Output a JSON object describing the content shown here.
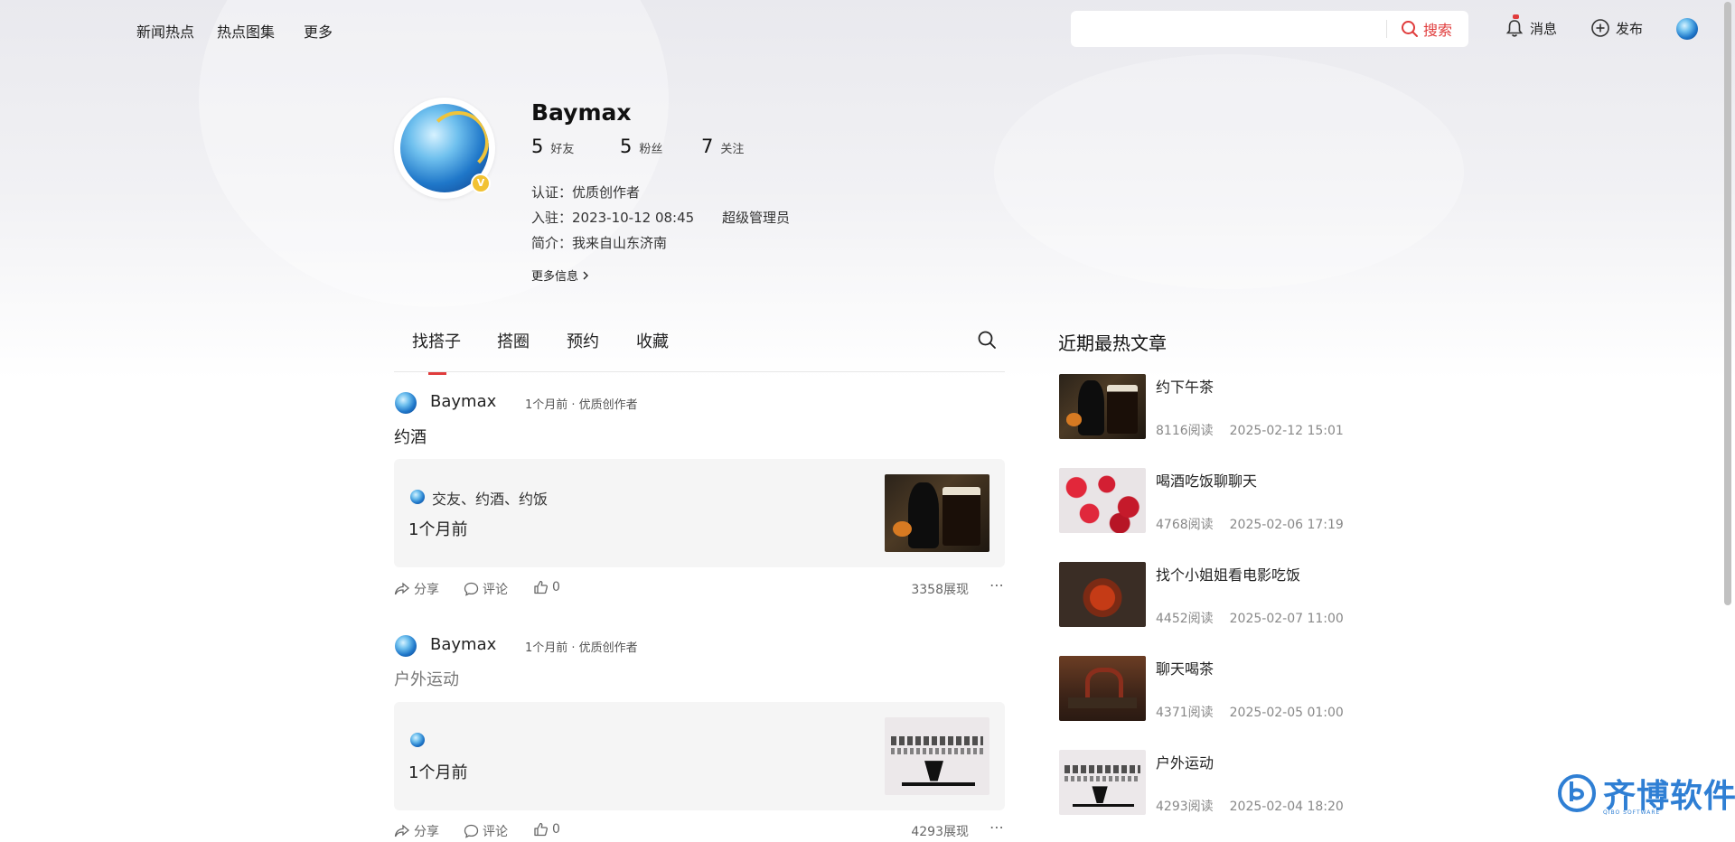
{
  "topnav": {
    "links": [
      "新闻热点",
      "热点图集",
      "更多"
    ],
    "search": {
      "placeholder": "",
      "button": "搜索"
    },
    "messages": "消息",
    "publish": "发布"
  },
  "profile": {
    "name": "Baymax",
    "badge": "V",
    "stats": [
      {
        "num": "5",
        "label": "好友"
      },
      {
        "num": "5",
        "label": "粉丝"
      },
      {
        "num": "7",
        "label": "关注"
      }
    ],
    "certification": "认证：优质创作者",
    "joined": "入驻：2023-10-12 08:45",
    "role": "超级管理员",
    "bio": "简介：我来自山东济南",
    "more_info": "更多信息"
  },
  "tabs": [
    "找搭子",
    "搭圈",
    "预约",
    "收藏"
  ],
  "feed": [
    {
      "author": "Baymax",
      "meta": "1个月前 · 优质创作者",
      "title": "约酒",
      "card_tags": "交友、约酒、约饭",
      "card_time": "1个月前",
      "share": "分享",
      "comment": "评论",
      "likes": "0",
      "views": "3358展现"
    },
    {
      "author": "Baymax",
      "meta": "1个月前 · 优质创作者",
      "title": "户外运动",
      "card_tags": "",
      "card_time": "1个月前",
      "share": "分享",
      "comment": "评论",
      "likes": "0",
      "views": "4293展现"
    }
  ],
  "sidebar": {
    "title": "近期最热文章",
    "articles": [
      {
        "title": "约下午茶",
        "reads": "8116阅读",
        "date": "2025-02-12 15:01"
      },
      {
        "title": "喝酒吃饭聊聊天",
        "reads": "4768阅读",
        "date": "2025-02-06 17:19"
      },
      {
        "title": "找个小姐姐看电影吃饭",
        "reads": "4452阅读",
        "date": "2025-02-07 11:00"
      },
      {
        "title": "聊天喝茶",
        "reads": "4371阅读",
        "date": "2025-02-05 01:00"
      },
      {
        "title": "户外运动",
        "reads": "4293阅读",
        "date": "2025-02-04 18:20"
      }
    ]
  },
  "watermark": {
    "text": "齐博软件",
    "sub": "QIBO SOFTWARE"
  },
  "colors": {
    "accent": "#e03c3c",
    "card_bg": "#f5f5f5",
    "muted": "#888888"
  }
}
